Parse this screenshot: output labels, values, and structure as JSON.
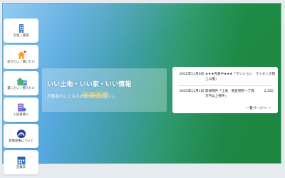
{
  "colors": {
    "accent_blue": "#3a7fc4",
    "nav_icon_blue": "#3a78c8",
    "nav_icon_orange": "#f0a030",
    "nav_icon_green": "#49b46a",
    "nav_icon_purple": "#8a6cc8"
  },
  "sidebar": {
    "items": [
      {
        "label": "空室／賃貸",
        "icon": "building-icon"
      },
      {
        "label": "売りたい／買いたい",
        "icon": "house-sale-icon"
      },
      {
        "label": "貸したい／借りたい",
        "icon": "house-parking-icon"
      },
      {
        "label": "入居者様へ",
        "icon": "resident-icon"
      },
      {
        "label": "新東商事について",
        "icon": "company-logo-icon"
      },
      {
        "label": "営業日",
        "icon": "calendar-icon"
      }
    ]
  },
  "hero": {
    "headline": "いい土地・いい家・いい情報",
    "subline": "不動産のことならおまかせください。",
    "brand_overlay": "新東商事"
  },
  "news": {
    "items": [
      {
        "date": "2025年11月6日",
        "text": "★★★売買中★★★「マンション　ライオンズ岡上公園」"
      },
      {
        "date": "2025年11月1日",
        "text": "新規物件「土地　南足柄市一丁目　　　2,250万円以上物件」"
      }
    ],
    "more_label": "一覧ページへ",
    "more_arrow": "→"
  }
}
